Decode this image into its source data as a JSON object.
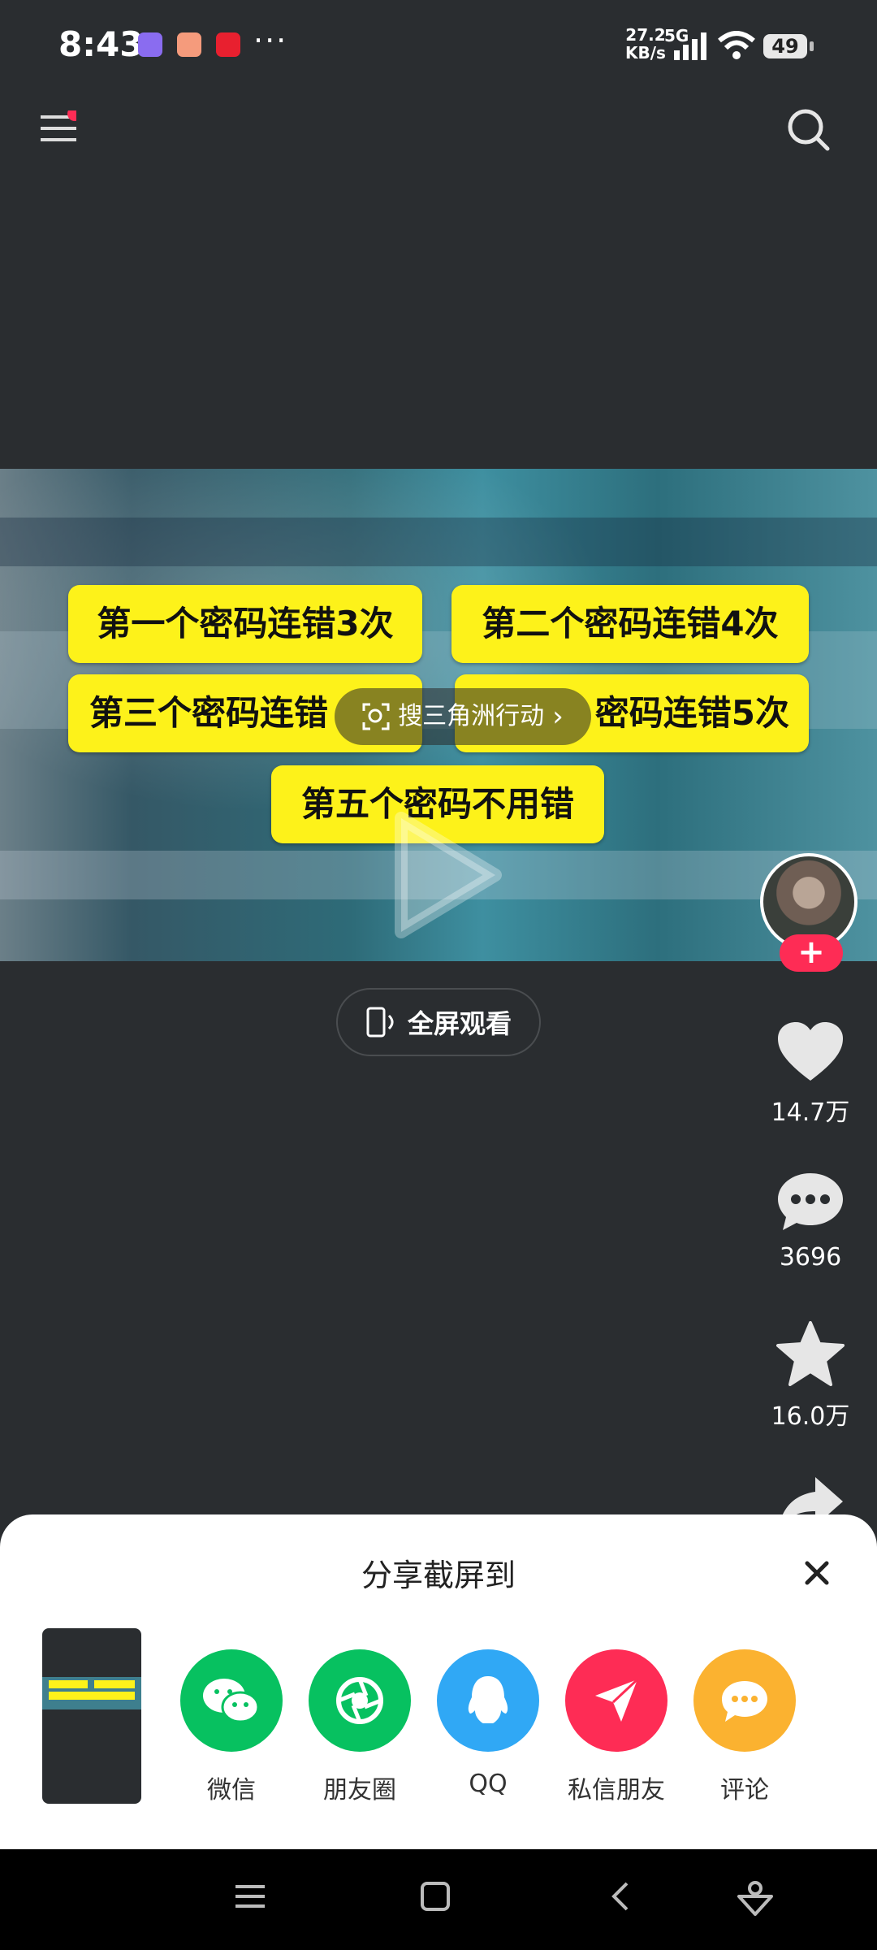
{
  "status_bar": {
    "time": "8:43",
    "net_speed_value": "27.2",
    "net_speed_unit": "KB/s",
    "network": "5G",
    "battery": "49",
    "more_dots": "···"
  },
  "video": {
    "pills": [
      "第一个密码连错3次",
      "第二个密码连错4次",
      "第三个密码连错",
      "密码连错5次",
      "第五个密码不用错"
    ],
    "search_overlay": "搜三角洲行动"
  },
  "fullscreen_label": "全屏观看",
  "actions": {
    "likes": "14.7万",
    "comments": "3696",
    "favorites": "16.0万"
  },
  "follow_label": "+",
  "share_sheet": {
    "title": "分享截屏到",
    "targets": [
      {
        "label": "微信",
        "color": "#07c160",
        "icon": "wechat-icon"
      },
      {
        "label": "朋友圈",
        "color": "#07c160",
        "icon": "moments-icon"
      },
      {
        "label": "QQ",
        "color": "#30a8f5",
        "icon": "qq-icon"
      },
      {
        "label": "私信朋友",
        "color": "#fe2c55",
        "icon": "send-icon"
      },
      {
        "label": "评论",
        "color": "#fbb230",
        "icon": "comment-icon"
      }
    ]
  }
}
